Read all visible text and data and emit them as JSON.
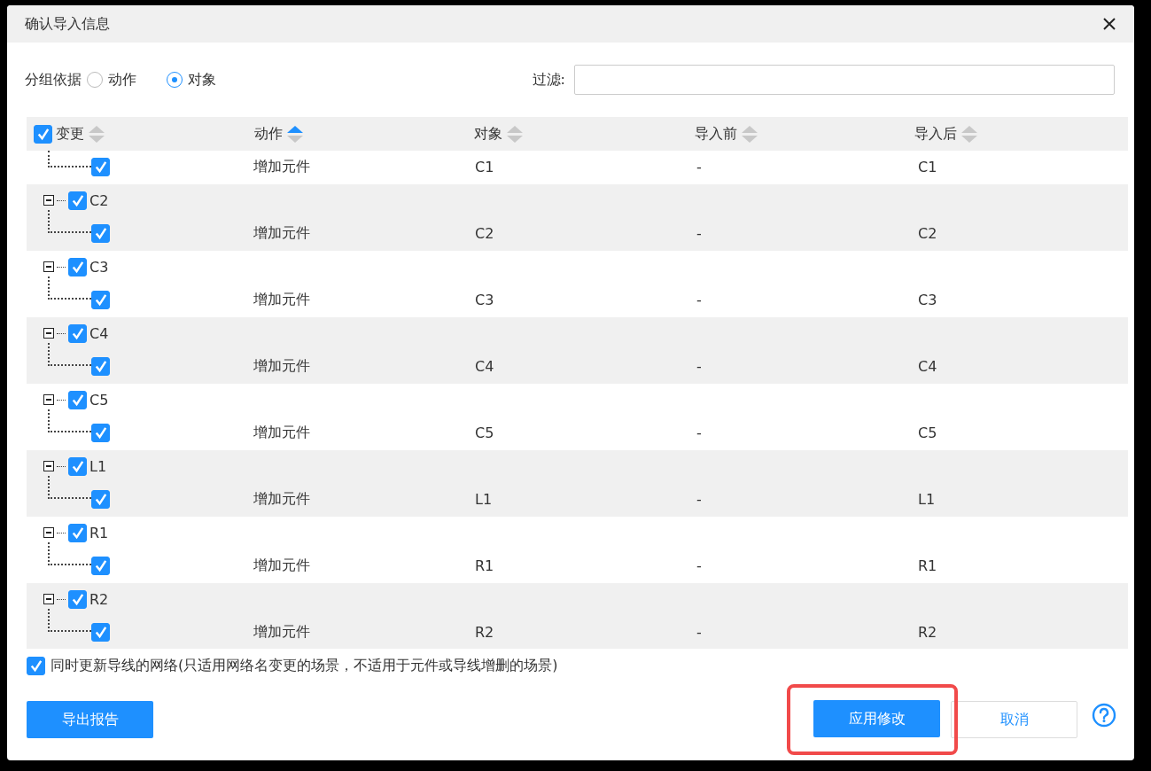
{
  "window": {
    "title": "确认导入信息"
  },
  "group_by": {
    "label": "分组依据",
    "options": [
      {
        "label": "动作",
        "selected": false
      },
      {
        "label": "对象",
        "selected": true
      }
    ]
  },
  "filter": {
    "label": "过滤:"
  },
  "table": {
    "header_checked": true,
    "columns": [
      {
        "label": "变更",
        "sorted": false
      },
      {
        "label": "动作",
        "sorted": true
      },
      {
        "label": "对象",
        "sorted": false
      },
      {
        "label": "导入前",
        "sorted": false
      },
      {
        "label": "导入后",
        "sorted": false
      }
    ],
    "groups": [
      {
        "children": [
          {
            "checked": true,
            "action": "增加元件",
            "object": "C1",
            "before": "-",
            "after": "C1"
          }
        ]
      },
      {
        "label": "C2",
        "checked": true,
        "expanded": true,
        "children": [
          {
            "checked": true,
            "action": "增加元件",
            "object": "C2",
            "before": "-",
            "after": "C2"
          }
        ]
      },
      {
        "label": "C3",
        "checked": true,
        "expanded": true,
        "children": [
          {
            "checked": true,
            "action": "增加元件",
            "object": "C3",
            "before": "-",
            "after": "C3"
          }
        ]
      },
      {
        "label": "C4",
        "checked": true,
        "expanded": true,
        "children": [
          {
            "checked": true,
            "action": "增加元件",
            "object": "C4",
            "before": "-",
            "after": "C4"
          }
        ]
      },
      {
        "label": "C5",
        "checked": true,
        "expanded": true,
        "children": [
          {
            "checked": true,
            "action": "增加元件",
            "object": "C5",
            "before": "-",
            "after": "C5"
          }
        ]
      },
      {
        "label": "L1",
        "checked": true,
        "expanded": true,
        "children": [
          {
            "checked": true,
            "action": "增加元件",
            "object": "L1",
            "before": "-",
            "after": "L1"
          }
        ]
      },
      {
        "label": "R1",
        "checked": true,
        "expanded": true,
        "children": [
          {
            "checked": true,
            "action": "增加元件",
            "object": "R1",
            "before": "-",
            "after": "R1"
          }
        ]
      },
      {
        "label": "R2",
        "checked": true,
        "expanded": true,
        "children": [
          {
            "checked": true,
            "action": "增加元件",
            "object": "R2",
            "before": "-",
            "after": "R2"
          }
        ]
      }
    ]
  },
  "update_nets": {
    "checked": true,
    "label": "同时更新导线的网络(只适用网络名变更的场景，不适用于元件或导线增删的场景)"
  },
  "buttons": {
    "export": "导出报告",
    "apply": "应用修改",
    "cancel": "取消"
  }
}
